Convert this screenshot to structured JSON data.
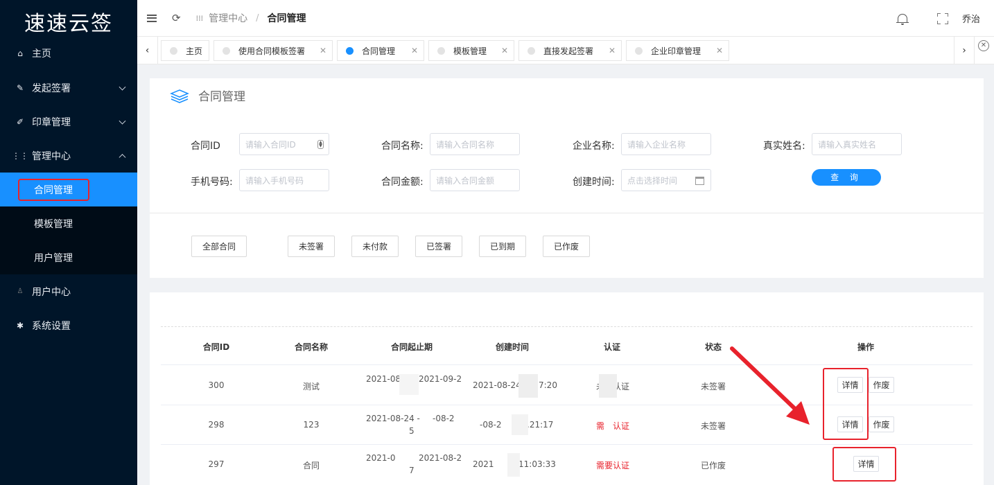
{
  "app": {
    "logo": "速速云签"
  },
  "sidebar": {
    "items": [
      {
        "label": "主页",
        "icon": "home-icon"
      },
      {
        "label": "发起签署",
        "icon": "edit-icon"
      },
      {
        "label": "印章管理",
        "icon": "pen-icon"
      },
      {
        "label": "管理中心",
        "icon": "grid-icon"
      },
      {
        "label": "用户中心",
        "icon": "user-icon"
      },
      {
        "label": "系统设置",
        "icon": "gear-icon"
      }
    ],
    "submenu": [
      "合同管理",
      "模板管理",
      "用户管理"
    ]
  },
  "header": {
    "breadcrumb_parent": "管理中心",
    "breadcrumb_current": "合同管理",
    "user_name": "乔治"
  },
  "tabs": [
    {
      "label": "主页"
    },
    {
      "label": "使用合同模板签署"
    },
    {
      "label": "合同管理"
    },
    {
      "label": "模板管理"
    },
    {
      "label": "直接发起签署"
    },
    {
      "label": "企业印章管理"
    }
  ],
  "search": {
    "title": "合同管理",
    "fields": [
      {
        "label": "合同ID",
        "placeholder": "请输入合同ID"
      },
      {
        "label": "合同名称:",
        "placeholder": "请输入合同名称"
      },
      {
        "label": "企业名称:",
        "placeholder": "请输入企业名称"
      },
      {
        "label": "真实姓名:",
        "placeholder": "请输入真实姓名"
      },
      {
        "label": "手机号码:",
        "placeholder": "请输入手机号码"
      },
      {
        "label": "合同金额:",
        "placeholder": "请输入合同金额"
      },
      {
        "label": "创建时间:",
        "placeholder": "点击选择时间"
      }
    ],
    "query_button": "查 询",
    "filters": [
      "全部合同",
      "未签署",
      "未付款",
      "已签署",
      "已到期",
      "已作废"
    ]
  },
  "table": {
    "columns": [
      "合同ID",
      "合同名称",
      "合同起止期",
      "创建时间",
      "认证",
      "状态",
      "操作"
    ],
    "rows": [
      {
        "id": "300",
        "name": "测试",
        "period_a": "2021-08",
        "period_b": "2021-09-2",
        "period_c": "",
        "created_a": "2021-08-24",
        "created_b": "7:20",
        "auth": "未",
        "auth_b": "认证",
        "auth_red": false,
        "status": "未签署",
        "detail": "详情",
        "void": "作废"
      },
      {
        "id": "298",
        "name": "123",
        "period_a": "2021-08-24 -",
        "period_b": "-08-2",
        "period_c": "5",
        "created_a": "-08-2",
        "created_b": ".21:17",
        "auth": "需",
        "auth_b": "认证",
        "auth_red": true,
        "status": "未签署",
        "detail": "详情",
        "void": "作废"
      },
      {
        "id": "297",
        "name": "合同",
        "period_a": "2021-0",
        "period_b": "2021-08-2",
        "period_c": "7",
        "created_a": "2021",
        "created_b": "11:03:33",
        "auth": "需要认证",
        "auth_b": "",
        "auth_red": true,
        "status": "已作废",
        "detail": "详情",
        "void": ""
      }
    ]
  },
  "colors": {
    "accent": "#1890ff",
    "sidebar_bg": "#001529",
    "annotation_red": "#e8222c"
  }
}
